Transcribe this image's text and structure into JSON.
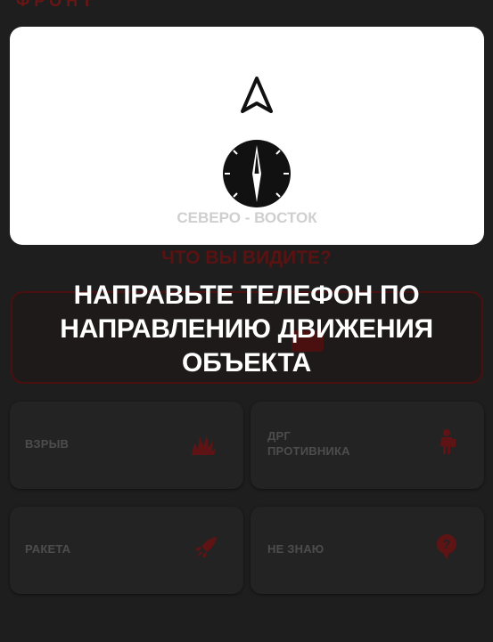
{
  "header": {
    "title": "ФРОНТ"
  },
  "compass_popup": {
    "direction": "СЕВЕРО - ВОСТОК"
  },
  "question": "ЧТО ВЫ ВИДИТЕ?",
  "instruction": {
    "line1": "НАПРАВЬТЕ ТЕЛЕФОН ПО",
    "line2": "НАПРАВЛЕНИЮ ДВИЖЕНИЯ",
    "line3": "ОБЪЕКТА"
  },
  "options": [
    {
      "label": "ВЗРЫВ",
      "icon": "explosion-icon"
    },
    {
      "label_line1": "ДРГ",
      "label_line2": "ПРОТИВНИКА",
      "icon": "soldier-icon"
    },
    {
      "label": "РАКЕТА",
      "icon": "rocket-icon"
    },
    {
      "label": "НЕ ЗНАЮ",
      "icon": "question-icon"
    }
  ],
  "colors": {
    "background": "#1e1e1e",
    "card": "#ffffff",
    "accent_dark_red": "#4a0f0f",
    "icon_red": "#5e1414"
  }
}
